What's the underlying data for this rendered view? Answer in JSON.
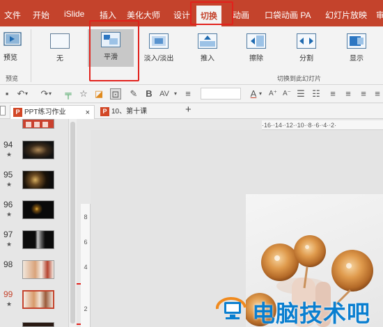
{
  "menu": {
    "items": [
      "文件",
      "开始",
      "iSlide",
      "插入",
      "美化大师",
      "设计",
      "切换",
      "动画",
      "口袋动画 PA",
      "幻灯片放映",
      "审"
    ],
    "active": "切换"
  },
  "ribbon": {
    "preview_label": "预览",
    "preview_group_label": "预览",
    "transitions": [
      "无",
      "平滑",
      "淡入/淡出",
      "推入",
      "擦除",
      "分割",
      "显示"
    ],
    "selected": "平滑",
    "group_label": "切换到此幻灯片"
  },
  "tabs": [
    {
      "label": "PPT练习作业",
      "icon": "powerpoint-file-icon"
    },
    {
      "label": "10、第十课",
      "icon": "powerpoint-file-icon"
    }
  ],
  "tab_close": "×",
  "tab_add": "+",
  "slides": [
    {
      "number": "94",
      "star": "★"
    },
    {
      "number": "95",
      "star": "★"
    },
    {
      "number": "96",
      "star": "★"
    },
    {
      "number": "97",
      "star": "★"
    },
    {
      "number": "98",
      "star": ""
    },
    {
      "number": "99",
      "star": "★"
    }
  ],
  "ruler_h": "·16·‧14·‧12·‧10·‧8·‧6·‧4·‧2·",
  "ruler_v": [
    "8",
    "6",
    "4",
    "2"
  ],
  "watermark": "电脑技术吧",
  "colors": {
    "accent": "#c4432c",
    "highlight": "#e2211c",
    "watermark": "#0a7fd0"
  }
}
